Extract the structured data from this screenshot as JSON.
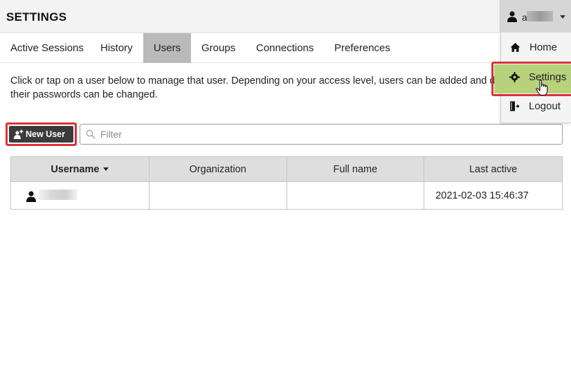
{
  "header": {
    "title": "SETTINGS"
  },
  "user_menu": {
    "username": "a"
  },
  "tabs": [
    {
      "label": "Active Sessions"
    },
    {
      "label": "History"
    },
    {
      "label": "Users"
    },
    {
      "label": "Groups"
    },
    {
      "label": "Connections"
    },
    {
      "label": "Preferences"
    }
  ],
  "active_tab": "Users",
  "intro": {
    "line1": "Click or tap on a user below to manage that user. Depending on your access level, users can be added and del",
    "line2": "their passwords can be changed."
  },
  "toolbar": {
    "new_user_label": "New User",
    "filter_placeholder": "Filter"
  },
  "table": {
    "columns": [
      "Username",
      "Organization",
      "Full name",
      "Last active"
    ],
    "sorted_column": "Username",
    "rows": [
      {
        "username": "",
        "organization": "",
        "full_name": "",
        "last_active": "2021-02-03 15:46:37"
      }
    ]
  },
  "dropdown": {
    "items": [
      {
        "label": "Home",
        "icon": "home-icon"
      },
      {
        "label": "Settings",
        "icon": "gear-icon"
      },
      {
        "label": "Logout",
        "icon": "logout-icon"
      }
    ]
  },
  "colors": {
    "header_bg": "#f3f3f3",
    "active_tab_bg": "#b9b9b9",
    "button_bg": "#3b3b3b",
    "highlight_red": "#d9323a",
    "settings_hover": "#b7d27b"
  }
}
